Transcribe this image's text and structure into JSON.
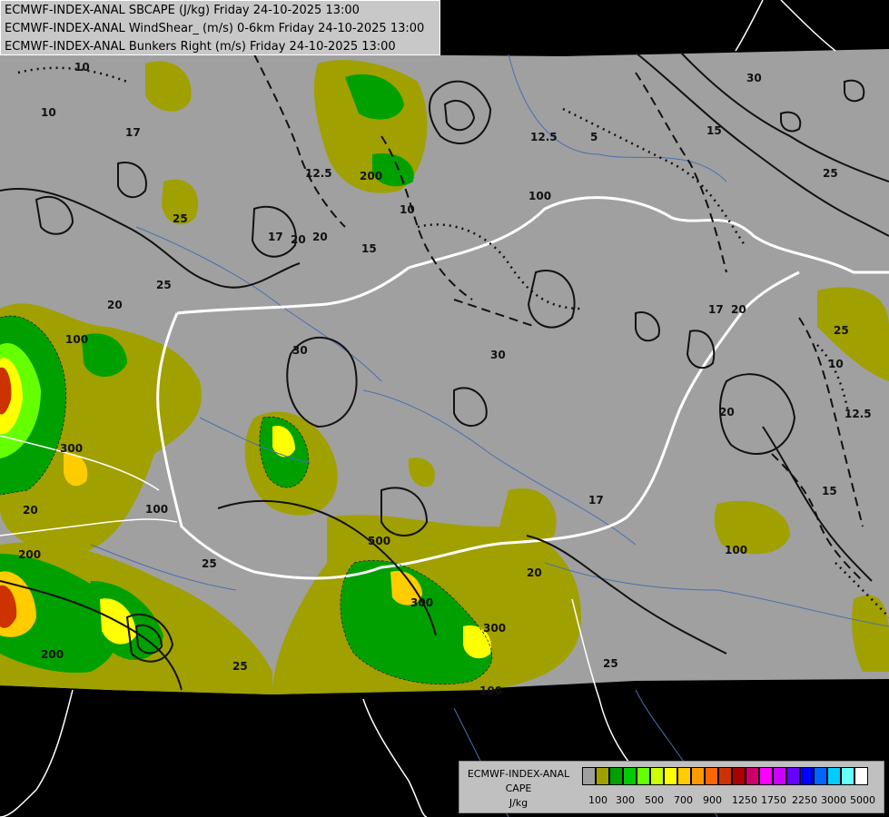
{
  "titles": [
    "ECMWF-INDEX-ANAL SBCAPE (J/kg) Friday 24-10-2025 13:00",
    "ECMWF-INDEX-ANAL WindShear_ (m/s) 0-6km Friday 24-10-2025 13:00",
    "ECMWF-INDEX-ANAL Bunkers Right (m/s) Friday 24-10-2025 13:00"
  ],
  "legend": {
    "title_lines": [
      "ECMWF-INDEX-ANAL",
      "CAPE",
      "J/kg"
    ],
    "colors": [
      "#a0a0a0",
      "#a0a000",
      "#00a000",
      "#00cc00",
      "#66ff00",
      "#ccff00",
      "#ffff00",
      "#ffcc00",
      "#ff9900",
      "#ff6600",
      "#cc3300",
      "#aa0000",
      "#cc0066",
      "#ff00ff",
      "#cc00ff",
      "#6600ff",
      "#0000ff",
      "#0066ff",
      "#00ccff",
      "#66ffff",
      "#ffffff"
    ],
    "labels": [
      "100",
      "300",
      "500",
      "700",
      "900",
      "1250",
      "1750",
      "2250",
      "3000",
      "5000"
    ]
  },
  "contour_labels": {
    "windshear": [
      "10",
      "17",
      "20",
      "25",
      "30",
      "12.5",
      "15",
      "25",
      "20",
      "17",
      "25",
      "30",
      "25",
      "20",
      "20",
      "17",
      "25",
      "20",
      "17",
      "30",
      "25",
      "20",
      "25",
      "20"
    ],
    "bunkers": [
      "10",
      "12.5",
      "15",
      "5",
      "10",
      "12.5",
      "15",
      "10"
    ],
    "cape": [
      "100",
      "200",
      "300",
      "100",
      "200",
      "100",
      "300",
      "100",
      "200",
      "300",
      "500",
      "100"
    ]
  },
  "map_colors": {
    "background": "#000000",
    "domain_fill": "#a0a0a0",
    "border_country": "#ffffff",
    "rivers": "#4a6fb0"
  }
}
